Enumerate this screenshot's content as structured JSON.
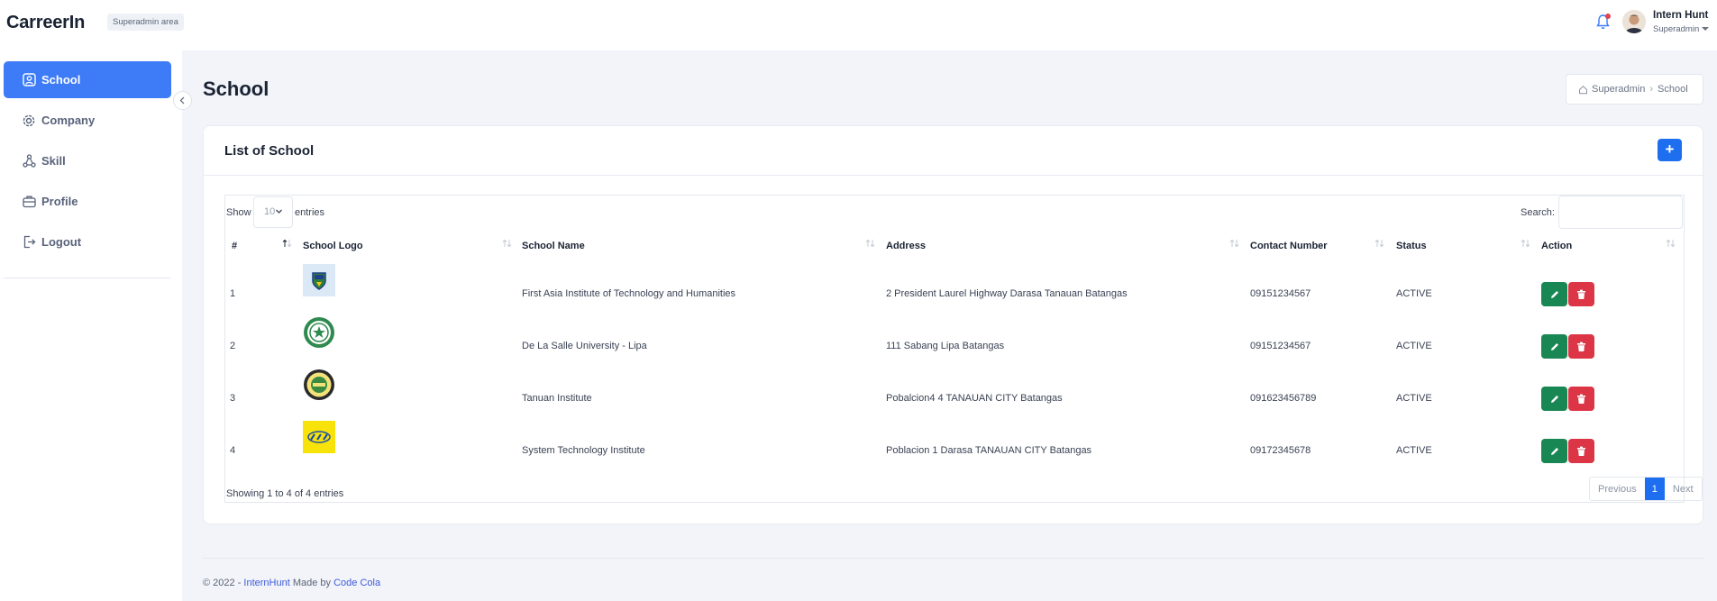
{
  "header": {
    "brand": "CarreerIn",
    "area_badge": "Superadmin area",
    "user_name": "Intern Hunt",
    "user_role": "Superadmin"
  },
  "sidebar": {
    "items": [
      {
        "label": "School",
        "icon": "user-square-icon",
        "active": true
      },
      {
        "label": "Company",
        "icon": "gear-icon",
        "active": false
      },
      {
        "label": "Skill",
        "icon": "nodes-icon",
        "active": false
      },
      {
        "label": "Profile",
        "icon": "briefcase-icon",
        "active": false
      },
      {
        "label": "Logout",
        "icon": "logout-icon",
        "active": false
      }
    ]
  },
  "page": {
    "title": "School",
    "breadcrumb": [
      "Superadmin",
      "School"
    ]
  },
  "card": {
    "title": "List of School",
    "add_label": "+"
  },
  "table": {
    "show_label": "Show",
    "entries_label": "entries",
    "page_length": "10",
    "search_label": "Search:",
    "columns": [
      "#",
      "School Logo",
      "School Name",
      "Address",
      "Contact Number",
      "Status",
      "Action"
    ],
    "rows": [
      {
        "num": "1",
        "name": "First Asia Institute of Technology and Humanities",
        "address": "2 President Laurel Highway Darasa Tanauan Batangas",
        "contact": "09151234567",
        "status": "ACTIVE"
      },
      {
        "num": "2",
        "name": "De La Salle University - Lipa",
        "address": "111 Sabang Lipa Batangas",
        "contact": "09151234567",
        "status": "ACTIVE"
      },
      {
        "num": "3",
        "name": "Tanuan Institute",
        "address": "Pobalcion4 4 TANAUAN CITY Batangas",
        "contact": "091623456789",
        "status": "ACTIVE"
      },
      {
        "num": "4",
        "name": "System Technology Institute",
        "address": "Poblacion 1 Darasa TANAUAN CITY Batangas",
        "contact": "09172345678",
        "status": "ACTIVE"
      }
    ],
    "info": "Showing 1 to 4 of 4 entries",
    "pager": {
      "prev": "Previous",
      "current": "1",
      "next": "Next"
    }
  },
  "footer": {
    "prefix": "© 2022 - ",
    "site": "InternHunt",
    "middle": " Made by ",
    "author": "Code Cola"
  },
  "colors": {
    "accent": "#3d7bf7",
    "primary_button": "#1d6ff0",
    "edit": "#198754",
    "delete": "#dc3545"
  }
}
